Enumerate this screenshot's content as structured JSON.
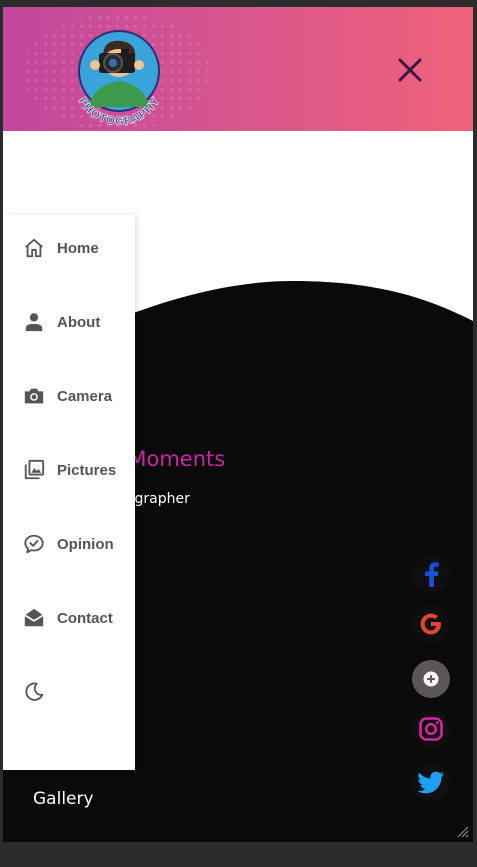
{
  "header": {
    "logo_text": "PHOTOGRAPHY",
    "close_icon": "close-icon",
    "colors": {
      "gradient_start": "#c0479e",
      "gradient_end": "#ef6278",
      "close": "#3b1546"
    }
  },
  "hero": {
    "title": "al Moments",
    "subtitle": "hotographer",
    "bottom_link": "Gallery",
    "colors": {
      "title": "#c724a6",
      "background": "#0a0a0a"
    }
  },
  "sidebar": {
    "items": [
      {
        "label": "Home",
        "icon": "home-icon"
      },
      {
        "label": "About",
        "icon": "person-icon"
      },
      {
        "label": "Camera",
        "icon": "camera-icon"
      },
      {
        "label": "Pictures",
        "icon": "pictures-icon"
      },
      {
        "label": "Opinion",
        "icon": "chat-check-icon"
      },
      {
        "label": "Contact",
        "icon": "mail-open-icon"
      },
      {
        "label": "",
        "icon": "moon-icon"
      }
    ]
  },
  "social": [
    {
      "name": "facebook",
      "icon": "facebook-icon",
      "color": "#1a4fd8"
    },
    {
      "name": "google",
      "icon": "google-icon",
      "color": "#e2452f"
    },
    {
      "name": "more",
      "icon": "plus-icon",
      "color": "#ffffff"
    },
    {
      "name": "instagram",
      "icon": "instagram-icon",
      "color": "#d6249f"
    },
    {
      "name": "twitter",
      "icon": "twitter-icon",
      "color": "#1da1f2"
    }
  ]
}
